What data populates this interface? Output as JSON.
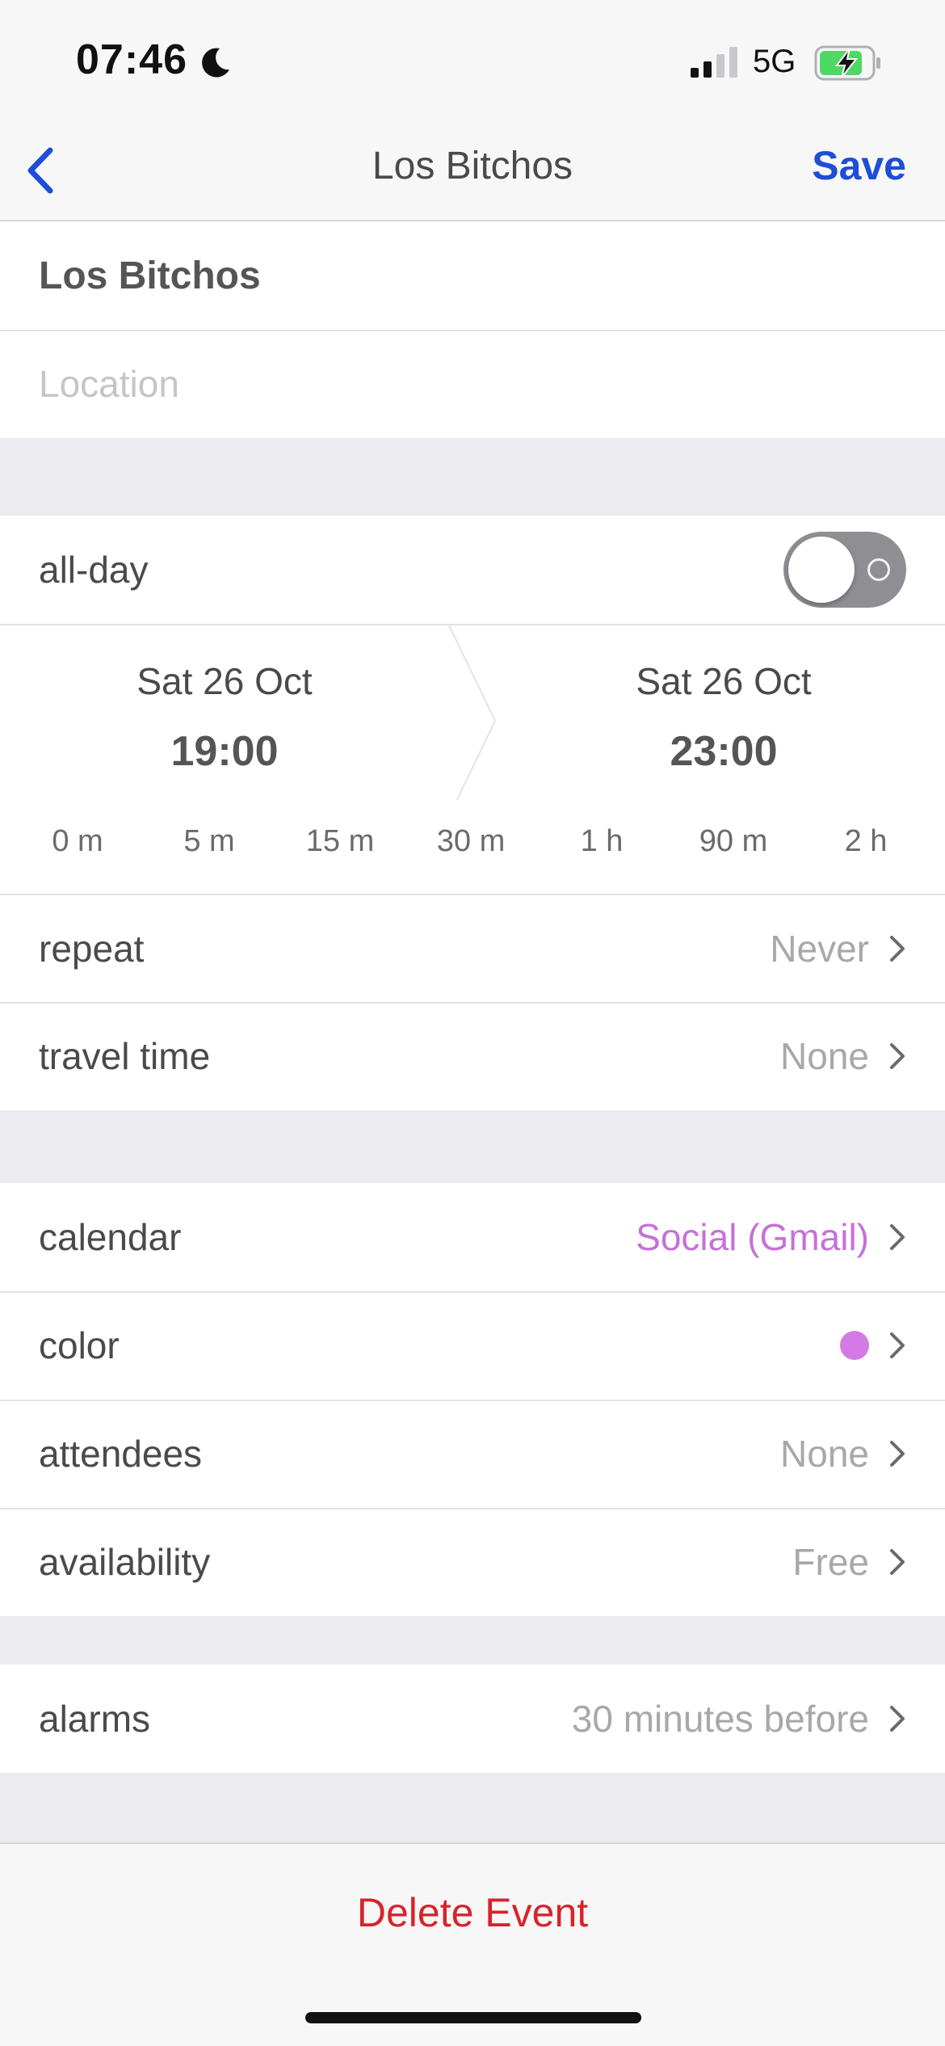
{
  "status_bar": {
    "time": "07:46",
    "network": "5G",
    "moon_icon": "moon-icon",
    "signal_icon": "signal-icon",
    "battery_icon": "battery-charging-icon",
    "battery_color": "#4cd964"
  },
  "nav": {
    "title": "Los Bitchos",
    "save_label": "Save",
    "back_icon": "chevron-left-icon",
    "accent": "#1c4fd6"
  },
  "event": {
    "title": "Los Bitchos",
    "location_placeholder": "Location"
  },
  "all_day": {
    "label": "all-day",
    "on": false
  },
  "dates": {
    "start_date": "Sat 26 Oct",
    "start_time": "19:00",
    "end_date": "Sat 26 Oct",
    "end_time": "23:00"
  },
  "quick_times": [
    "0 m",
    "5 m",
    "15 m",
    "30 m",
    "1 h",
    "90 m",
    "2 h"
  ],
  "details": {
    "repeat": {
      "label": "repeat",
      "value": "Never"
    },
    "travel_time": {
      "label": "travel time",
      "value": "None"
    }
  },
  "calendar_group": {
    "calendar": {
      "label": "calendar",
      "value": "Social (Gmail)",
      "color": "#c770d8"
    },
    "color": {
      "label": "color",
      "dot_color": "#d37ae6"
    },
    "attendees": {
      "label": "attendees",
      "value": "None"
    },
    "availability": {
      "label": "availability",
      "value": "Free"
    }
  },
  "alarms": {
    "label": "alarms",
    "value": "30 minutes before"
  },
  "delete": {
    "label": "Delete Event",
    "color": "#d7232b"
  }
}
